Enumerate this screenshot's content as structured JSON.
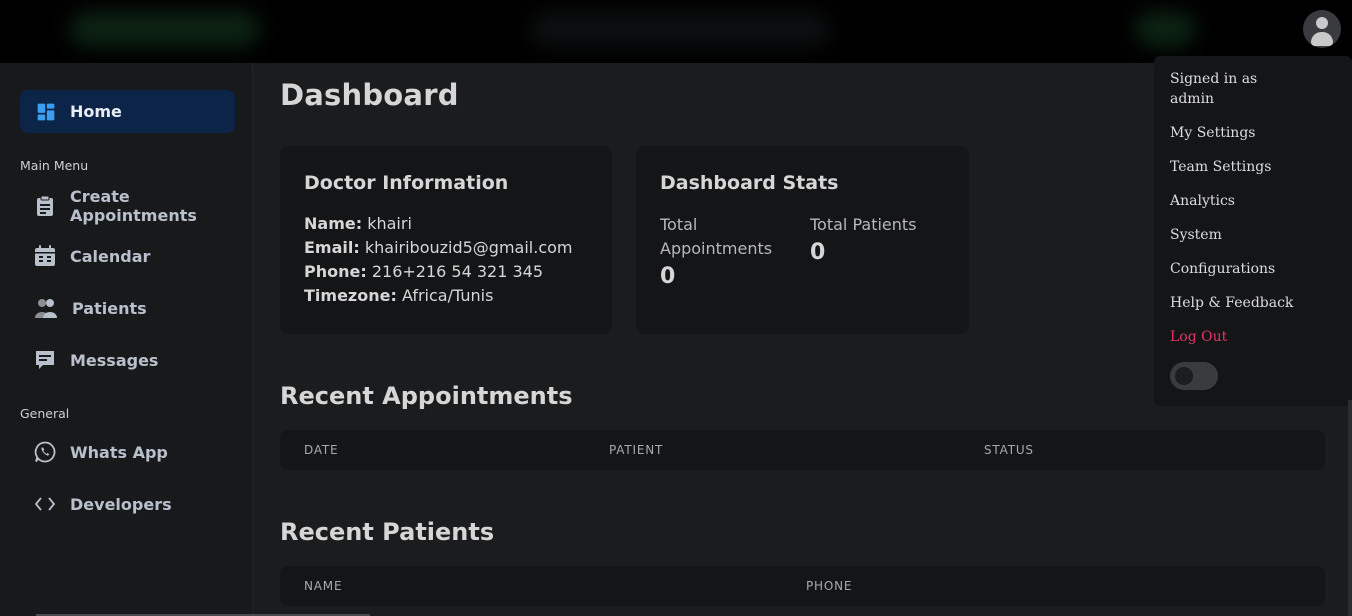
{
  "sidebar": {
    "home_label": "Home",
    "main_menu_label": "Main Menu",
    "items": [
      {
        "label": "Create\nAppointments",
        "icon": "clipboard-icon"
      },
      {
        "label": "Calendar",
        "icon": "calendar-icon"
      },
      {
        "label": "Patients",
        "icon": "users-icon"
      },
      {
        "label": "Messages",
        "icon": "message-icon"
      }
    ],
    "general_label": "General",
    "general_items": [
      {
        "label": "Whats App",
        "icon": "whatsapp-icon"
      },
      {
        "label": "Developers",
        "icon": "code-icon"
      }
    ]
  },
  "main": {
    "title": "Dashboard",
    "doctor_card": {
      "title": "Doctor Information",
      "name_label": "Name:",
      "name": "khairi",
      "email_label": "Email:",
      "email": "khairibouzid5@gmail.com",
      "phone_label": "Phone:",
      "phone": "216+216 54 321 345",
      "timezone_label": "Timezone:",
      "timezone": "Africa/Tunis"
    },
    "stats_card": {
      "title": "Dashboard Stats",
      "total_appointments_label_1": "Total",
      "total_appointments_label_2": "Appointments",
      "total_appointments": "0",
      "total_patients_label": "Total Patients",
      "total_patients": "0"
    },
    "recent_appointments": {
      "title": "Recent Appointments",
      "columns": [
        "DATE",
        "PATIENT",
        "STATUS"
      ]
    },
    "recent_patients": {
      "title": "Recent Patients",
      "columns": [
        "NAME",
        "PHONE"
      ]
    }
  },
  "dropdown": {
    "signed_in_1": "Signed in as",
    "signed_in_2": "admin",
    "items": [
      "My Settings",
      "Team Settings",
      "Analytics",
      "System",
      "Configurations",
      "Help & Feedback"
    ],
    "logout": "Log Out"
  },
  "colors": {
    "accent_home": "#0b2447",
    "logout": "#e5336b",
    "home_icon": "#3b9cf0"
  }
}
